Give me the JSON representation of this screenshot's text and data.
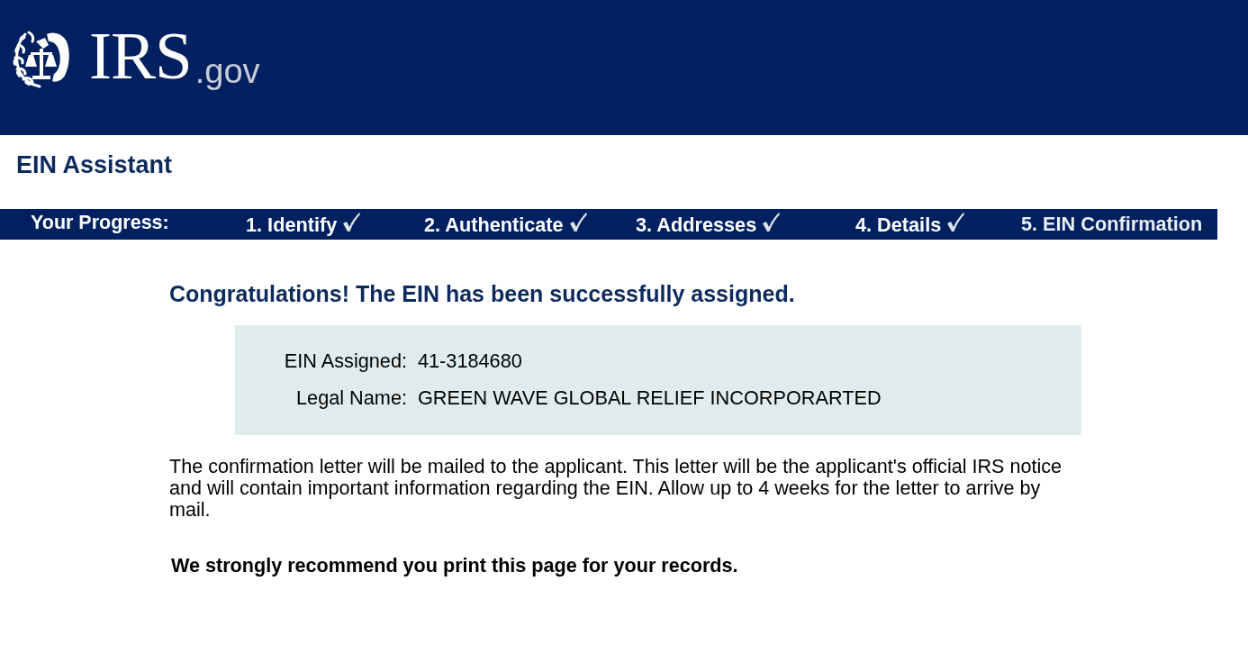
{
  "header": {
    "logo_text": "IRS",
    "logo_suffix": ".gov"
  },
  "app_title": "EIN Assistant",
  "progress": {
    "label": "Your Progress:",
    "steps": [
      {
        "label": "1. Identify",
        "completed": true
      },
      {
        "label": "2. Authenticate",
        "completed": true
      },
      {
        "label": "3. Addresses",
        "completed": true
      },
      {
        "label": "4. Details",
        "completed": true
      },
      {
        "label": "5. EIN Confirmation",
        "completed": false
      }
    ]
  },
  "confirmation": {
    "heading": "Congratulations! The EIN has been successfully assigned.",
    "details": [
      {
        "label": "EIN Assigned:",
        "value": "41-3184680"
      },
      {
        "label": "Legal Name:",
        "value": "GREEN WAVE GLOBAL RELIEF INCORPORARTED"
      }
    ],
    "message": "The confirmation letter will be mailed to the applicant. This letter will be the applicant's official IRS notice and will contain important information regarding the EIN. Allow up to 4 weeks for the letter to arrive by mail.",
    "recommendation": "We strongly recommend you print this page for your records."
  }
}
